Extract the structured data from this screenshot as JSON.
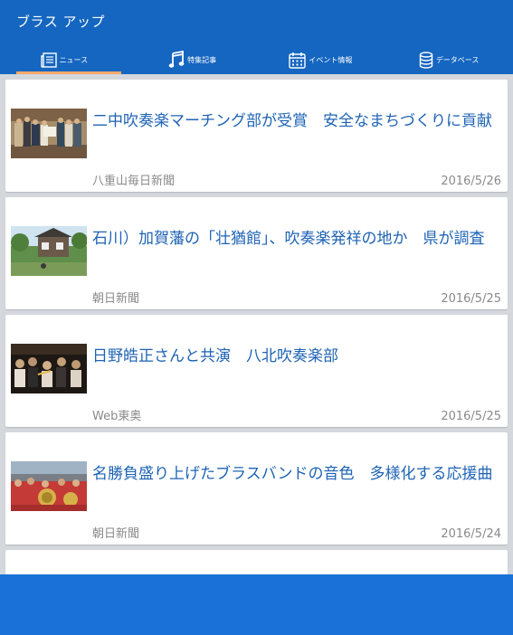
{
  "app": {
    "title": "ブラス アップ"
  },
  "tabs": [
    {
      "label": "ニュース",
      "icon": "newspaper-icon",
      "active": true
    },
    {
      "label": "特集記事",
      "icon": "music-note-icon",
      "active": false
    },
    {
      "label": "イベント情報",
      "icon": "calendar-icon",
      "active": false
    },
    {
      "label": "データベース",
      "icon": "database-icon",
      "active": false
    }
  ],
  "articles": [
    {
      "headline": "二中吹奏楽マーチング部が受賞　安全なまちづくりに貢献",
      "source": "八重山毎日新聞",
      "date": "2016/5/26"
    },
    {
      "headline": "石川）加賀藩の「壮猶館」、吹奏楽発祥の地か　県が調査",
      "source": "朝日新聞",
      "date": "2016/5/25"
    },
    {
      "headline": "日野皓正さんと共演　八北吹奏楽部",
      "source": "Web東奥",
      "date": "2016/5/25"
    },
    {
      "headline": "名勝負盛り上げたブラスバンドの音色　多様化する応援曲",
      "source": "朝日新聞",
      "date": "2016/5/24"
    }
  ],
  "colors": {
    "primary": "#1566c0",
    "accent": "#f3a96b",
    "link": "#1e63b4",
    "background": "#d4d8dc",
    "bottom_bar": "#1a72d8"
  }
}
